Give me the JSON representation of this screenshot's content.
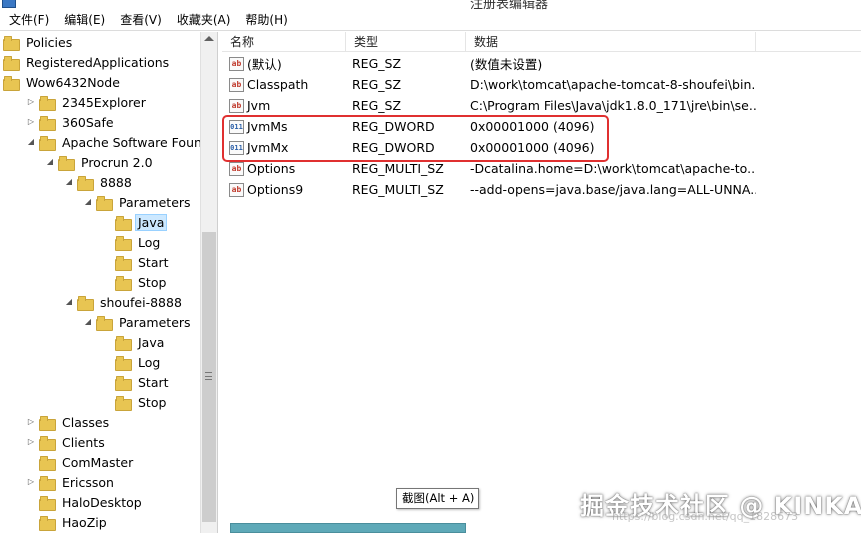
{
  "window": {
    "title": "注册表编辑器"
  },
  "menu": [
    "文件(F)",
    "编辑(E)",
    "查看(V)",
    "收藏夹(A)",
    "帮助(H)"
  ],
  "tree": [
    {
      "label": "Policies",
      "level": 0,
      "expander": "none"
    },
    {
      "label": "RegisteredApplications",
      "level": 0,
      "expander": "none"
    },
    {
      "label": "Wow6432Node",
      "level": 0,
      "expander": "expanded"
    },
    {
      "label": "2345Explorer",
      "level": 1,
      "expander": "collapsed"
    },
    {
      "label": "360Safe",
      "level": 1,
      "expander": "collapsed"
    },
    {
      "label": "Apache Software Foundatic",
      "level": 1,
      "expander": "expanded"
    },
    {
      "label": "Procrun 2.0",
      "level": 2,
      "expander": "expanded"
    },
    {
      "label": "8888",
      "level": 3,
      "expander": "expanded"
    },
    {
      "label": "Parameters",
      "level": 4,
      "expander": "expanded"
    },
    {
      "label": "Java",
      "level": 5,
      "expander": "none",
      "selected": true
    },
    {
      "label": "Log",
      "level": 5,
      "expander": "none"
    },
    {
      "label": "Start",
      "level": 5,
      "expander": "none"
    },
    {
      "label": "Stop",
      "level": 5,
      "expander": "none"
    },
    {
      "label": "shoufei-8888",
      "level": 3,
      "expander": "expanded"
    },
    {
      "label": "Parameters",
      "level": 4,
      "expander": "expanded"
    },
    {
      "label": "Java",
      "level": 5,
      "expander": "none"
    },
    {
      "label": "Log",
      "level": 5,
      "expander": "none"
    },
    {
      "label": "Start",
      "level": 5,
      "expander": "none"
    },
    {
      "label": "Stop",
      "level": 5,
      "expander": "none"
    },
    {
      "label": "Classes",
      "level": 1,
      "expander": "collapsed"
    },
    {
      "label": "Clients",
      "level": 1,
      "expander": "collapsed"
    },
    {
      "label": "ComMaster",
      "level": 1,
      "expander": "none"
    },
    {
      "label": "Ericsson",
      "level": 1,
      "expander": "collapsed"
    },
    {
      "label": "HaloDesktop",
      "level": 1,
      "expander": "none"
    },
    {
      "label": "HaoZip",
      "level": 1,
      "expander": "none"
    }
  ],
  "list": {
    "columns": {
      "name": "名称",
      "type": "类型",
      "data": "数据"
    },
    "rows": [
      {
        "icon": "ab",
        "name": "(默认)",
        "type": "REG_SZ",
        "data": "(数值未设置)"
      },
      {
        "icon": "ab",
        "name": "Classpath",
        "type": "REG_SZ",
        "data": "D:\\work\\tomcat\\apache-tomcat-8-shoufei\\bin..."
      },
      {
        "icon": "ab",
        "name": "Jvm",
        "type": "REG_SZ",
        "data": "C:\\Program Files\\Java\\jdk1.8.0_171\\jre\\bin\\se..."
      },
      {
        "icon": "dword",
        "name": "JvmMs",
        "type": "REG_DWORD",
        "data": "0x00001000 (4096)"
      },
      {
        "icon": "dword",
        "name": "JvmMx",
        "type": "REG_DWORD",
        "data": "0x00001000 (4096)"
      },
      {
        "icon": "ab",
        "name": "Options",
        "type": "REG_MULTI_SZ",
        "data": "-Dcatalina.home=D:\\work\\tomcat\\apache-to..."
      },
      {
        "icon": "ab",
        "name": "Options9",
        "type": "REG_MULTI_SZ",
        "data": "--add-opens=java.base/java.lang=ALL-UNNA..."
      }
    ]
  },
  "tooltip": "截图(Alt + A)",
  "watermark": "掘金技术社区 @ KINKA",
  "watermark_url": "https://blog.csdn.net/qq_1828673",
  "colors": {
    "highlight": "#e03030",
    "selection": "#cce8ff",
    "folder": "#e8c552"
  }
}
